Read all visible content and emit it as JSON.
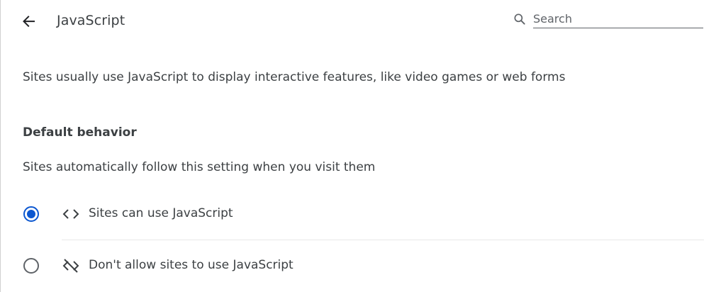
{
  "header": {
    "back_icon": "arrow-left-icon",
    "title": "JavaScript",
    "search": {
      "icon": "search-icon",
      "placeholder": "Search",
      "value": ""
    }
  },
  "main": {
    "description": "Sites usually use JavaScript to display interactive features, like video games or web forms",
    "default_behavior": {
      "heading": "Default behavior",
      "subtext": "Sites automatically follow this setting when you visit them",
      "options": [
        {
          "label": "Sites can use JavaScript",
          "icon": "code-brackets-icon",
          "selected": true
        },
        {
          "label": "Don't allow sites to use JavaScript",
          "icon": "code-off-icon",
          "selected": false
        }
      ]
    }
  },
  "colors": {
    "accent": "#0b57d0",
    "text": "#3c4043",
    "icon": "#5f6368",
    "divider": "#e8e8e8"
  }
}
